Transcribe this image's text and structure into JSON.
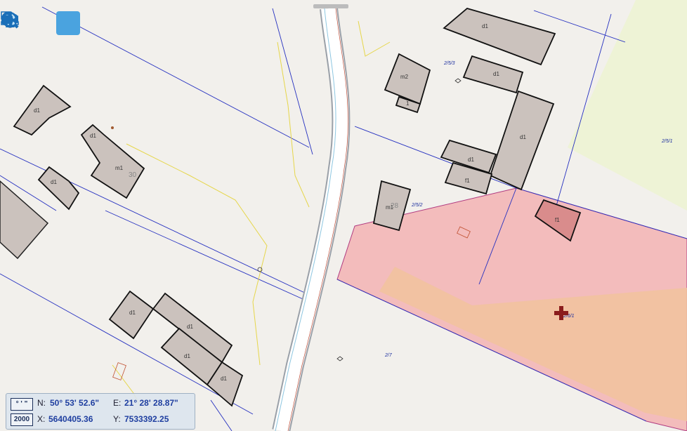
{
  "toolbar": {
    "buttons": [
      {
        "name": "zoom-in-button",
        "icon": "zoom-in-icon"
      },
      {
        "name": "zoom-out-button",
        "icon": "zoom-out-icon"
      },
      {
        "name": "pan-button",
        "icon": "hand-icon",
        "active": true
      },
      {
        "name": "zoom-extent-button",
        "icon": "zoom-extent-icon"
      },
      {
        "name": "back-button",
        "icon": "arrow-left-icon"
      },
      {
        "name": "forward-button",
        "icon": "arrow-right-icon"
      },
      {
        "name": "link-button",
        "icon": "link-icon"
      },
      {
        "name": "info-button",
        "icon": "info-icon"
      },
      {
        "name": "info-area-button",
        "icon": "info-area-icon"
      },
      {
        "name": "measure-button",
        "icon": "ruler-icon"
      },
      {
        "name": "globe-button",
        "icon": "globe-icon"
      },
      {
        "name": "video-button",
        "icon": "video-camera-icon"
      }
    ]
  },
  "map_labels": {
    "buildings": [
      "d1",
      "m1",
      "d1",
      "m2",
      "1",
      "d1",
      "d1",
      "d1",
      "m1",
      "f1",
      "f1",
      "m1",
      "d1",
      "d1",
      "d1",
      "d1",
      "d1"
    ],
    "house_numbers": [
      "30",
      "28"
    ],
    "plots": [
      "2/5/3",
      "2/5/1",
      "2/5/2",
      "2/7",
      "2/6/1"
    ]
  },
  "coords_panel": {
    "format_button": "° ' \"",
    "system_button": "2000",
    "n_label": "N:",
    "n_value": "50° 53' 52.6\"",
    "e_label": "E:",
    "e_value": "21° 28' 28.87\"",
    "x_label": "X:",
    "x_value": "5640405.36",
    "y_label": "Y:",
    "y_value": "7533392.25"
  },
  "colors": {
    "highlight_fill": "#f3bcbc",
    "inner_fill": "#f3c09e",
    "building": "#cbc2bd",
    "accent": "#4aa3df"
  }
}
